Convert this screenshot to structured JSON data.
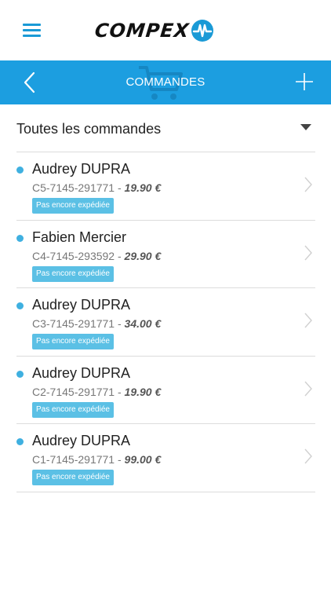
{
  "header": {
    "logo_text": "COMPEX",
    "menu_icon": "hamburger-icon",
    "brand_color": "#1a9ad6"
  },
  "navbar": {
    "title": "COMMANDES",
    "back_icon": "chevron-left-icon",
    "add_icon": "plus-icon",
    "watermark_icon": "cart-icon",
    "bg_color": "#1c9ee0"
  },
  "filter": {
    "label": "Toutes les commandes",
    "icon": "caret-down-icon"
  },
  "orders": [
    {
      "name": "Audrey DUPRA",
      "ref": "C5-7145-291771",
      "separator": " - ",
      "price": "19.90 €",
      "status": "Pas encore expédiée"
    },
    {
      "name": "Fabien Mercier",
      "ref": "C4-7145-293592",
      "separator": " - ",
      "price": "29.90 €",
      "status": "Pas encore expédiée"
    },
    {
      "name": "Audrey DUPRA",
      "ref": "C3-7145-291771",
      "separator": " - ",
      "price": "34.00 €",
      "status": "Pas encore expédiée"
    },
    {
      "name": "Audrey DUPRA",
      "ref": "C2-7145-291771",
      "separator": " - ",
      "price": "19.90 €",
      "status": "Pas encore expédiée"
    },
    {
      "name": "Audrey DUPRA",
      "ref": "C1-7145-291771",
      "separator": " - ",
      "price": "99.00 €",
      "status": "Pas encore expédiée"
    }
  ],
  "colors": {
    "status_badge": "#5bc0e5",
    "unread_dot": "#3fb0e0"
  }
}
